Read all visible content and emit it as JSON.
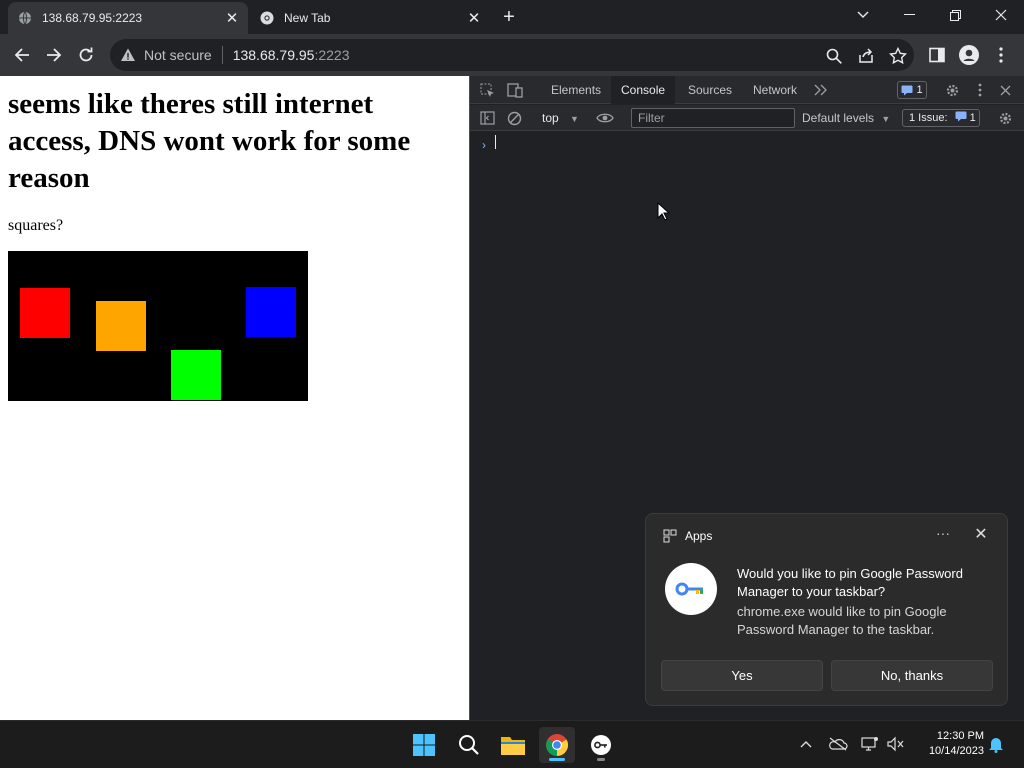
{
  "browser": {
    "tabs": [
      {
        "title": "138.68.79.95:2223",
        "active": true
      },
      {
        "title": "New Tab",
        "active": false
      }
    ],
    "new_tab_label": "+",
    "address": {
      "security_text": "Not secure",
      "host": "138.68.79.95",
      "port": ":2223"
    }
  },
  "page": {
    "heading": "seems like theres still internet access, DNS wont work for some reason",
    "text": "squares?",
    "squares": [
      {
        "color": "#ff0000",
        "name": "red"
      },
      {
        "color": "#ffa500",
        "name": "orange"
      },
      {
        "color": "#00ff00",
        "name": "green"
      },
      {
        "color": "#0000ff",
        "name": "blue"
      }
    ]
  },
  "devtools": {
    "tabs": [
      "Elements",
      "Console",
      "Sources",
      "Network"
    ],
    "active_tab": "Console",
    "issues_badge": "1",
    "context": "top",
    "filter_placeholder": "Filter",
    "levels": "Default levels",
    "issues_text": "1 Issue:",
    "issues_count": "1",
    "prompt": "›"
  },
  "notification": {
    "app_name": "Apps",
    "more": "···",
    "title": "Would you like to pin Google Password Manager to your taskbar?",
    "body": "chrome.exe would like to pin Google Password Manager to the taskbar.",
    "yes_label": "Yes",
    "no_label": "No, thanks"
  },
  "taskbar": {
    "time": "12:30 PM",
    "date": "10/14/2023"
  },
  "colors": {
    "accent": "#4cc2ff",
    "chrome_dark": "#202124",
    "toolbar": "#35363a"
  }
}
